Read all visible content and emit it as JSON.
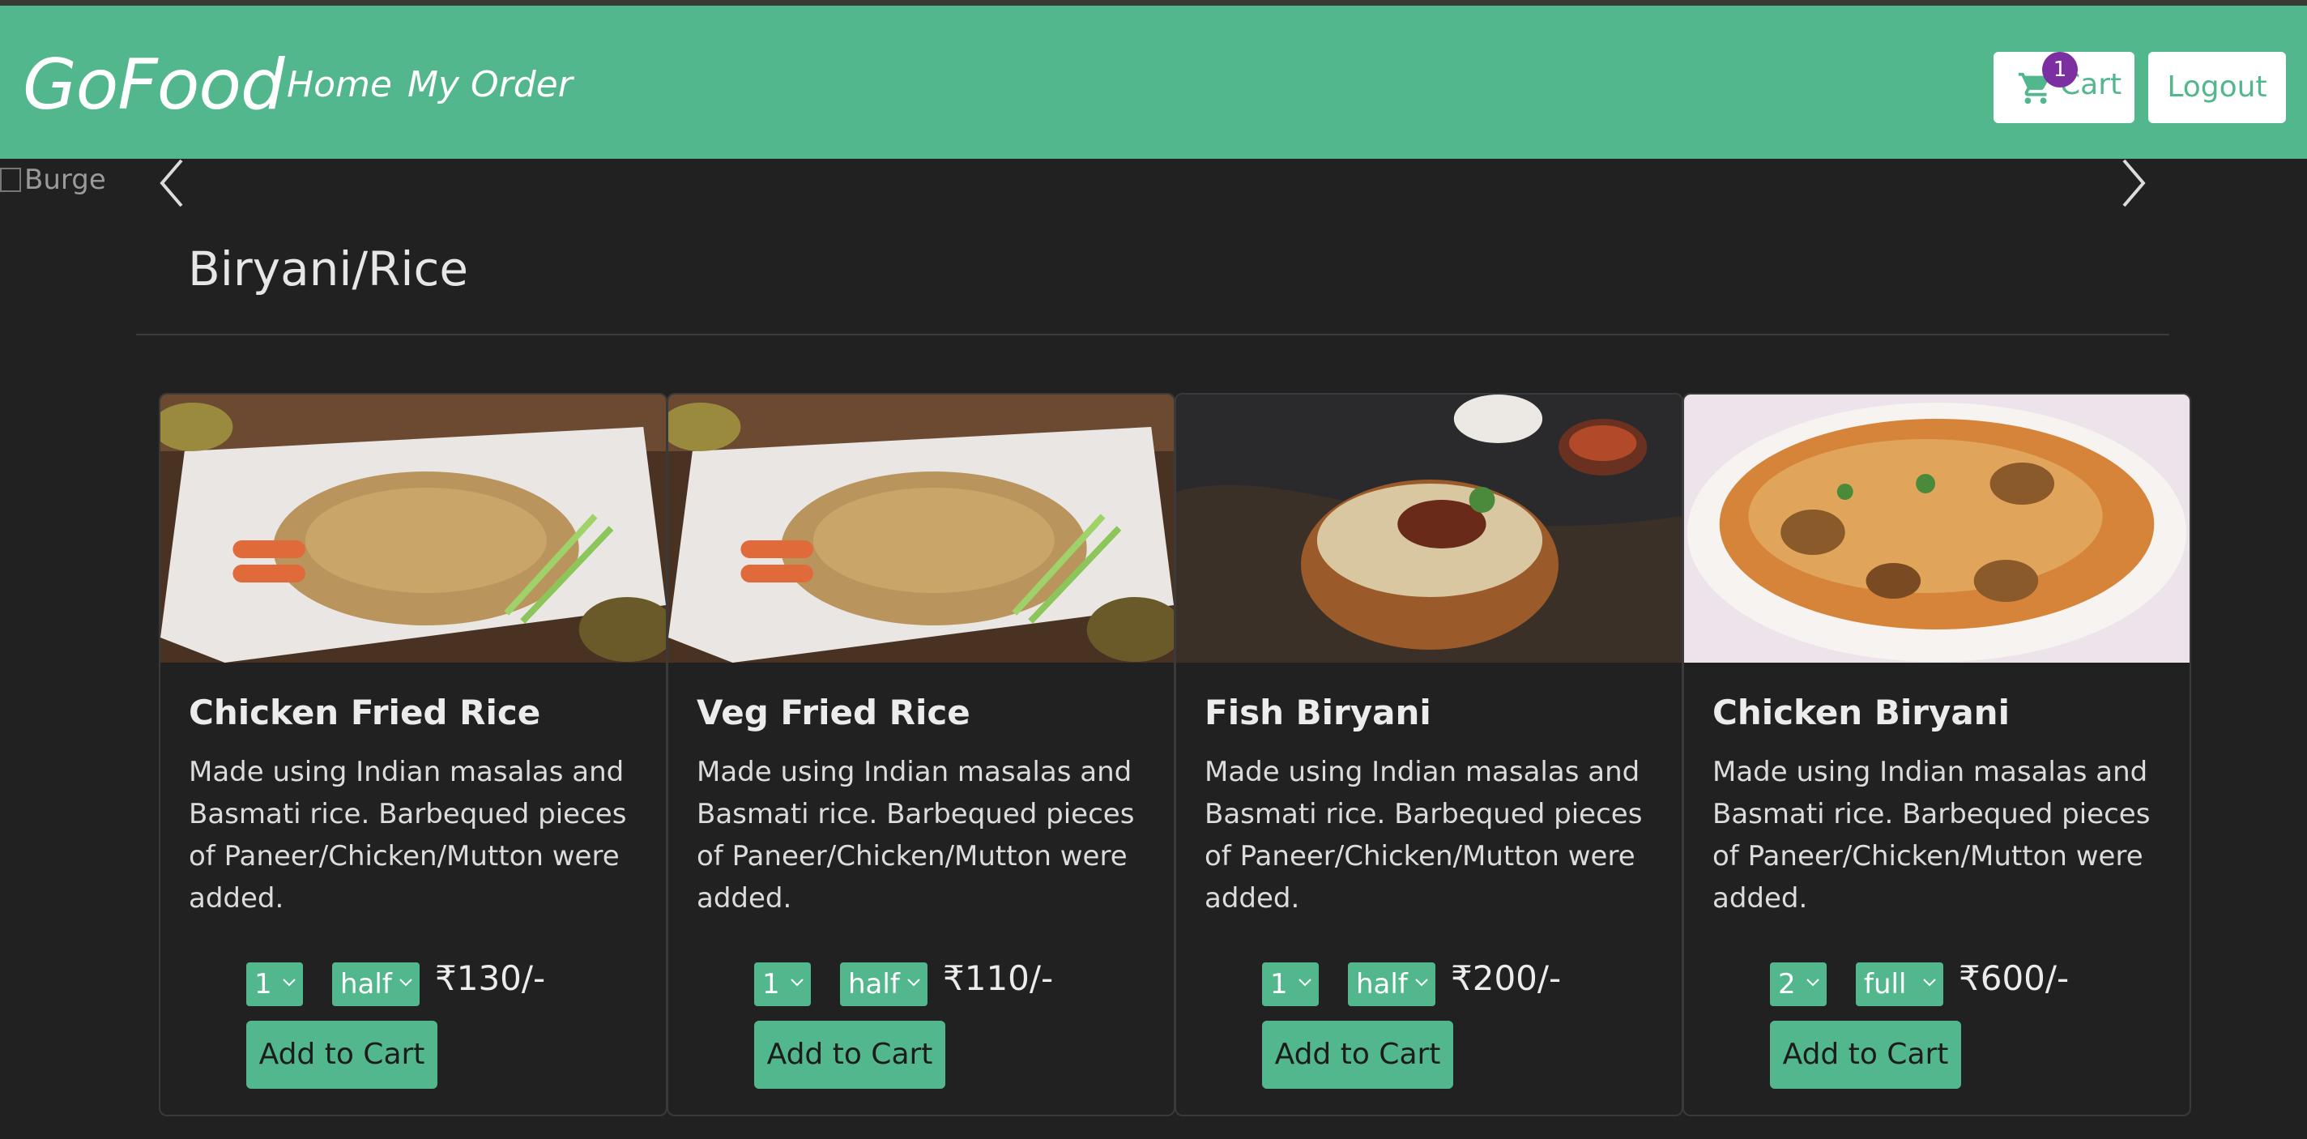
{
  "navbar": {
    "brand": "GoFood",
    "links": [
      {
        "label": "Home"
      },
      {
        "label": "My Order"
      }
    ],
    "cart": {
      "label": "Cart",
      "badge_count": "1",
      "icon": "cart-icon"
    },
    "logout_label": "Logout"
  },
  "carousel": {
    "image_alt": "Burge",
    "prev_icon": "chevron-left-icon",
    "next_icon": "chevron-right-icon"
  },
  "category": {
    "title": "Biryani/Rice"
  },
  "cards": [
    {
      "name": "Chicken Fried Rice",
      "description": "Made using Indian masalas and Basmati rice. Barbequed pieces of Paneer/Chicken/Mutton were added.",
      "qty": "1",
      "size": "half",
      "price": "₹130/-",
      "button": "Add to Cart"
    },
    {
      "name": "Veg Fried Rice",
      "description": "Made using Indian masalas and Basmati rice. Barbequed pieces of Paneer/Chicken/Mutton were added.",
      "qty": "1",
      "size": "half",
      "price": "₹110/-",
      "button": "Add to Cart"
    },
    {
      "name": "Fish Biryani",
      "description": "Made using Indian masalas and Basmati rice. Barbequed pieces of Paneer/Chicken/Mutton were added.",
      "qty": "1",
      "size": "half",
      "price": "₹200/-",
      "button": "Add to Cart"
    },
    {
      "name": "Chicken Biryani",
      "description": "Made using Indian masalas and Basmati rice. Barbequed pieces of Paneer/Chicken/Mutton were added.",
      "qty": "2",
      "size": "full",
      "price": "₹600/-",
      "button": "Add to Cart"
    }
  ],
  "colors": {
    "accent": "#52b78c",
    "background": "#212121",
    "badge": "#7b2fa0"
  }
}
